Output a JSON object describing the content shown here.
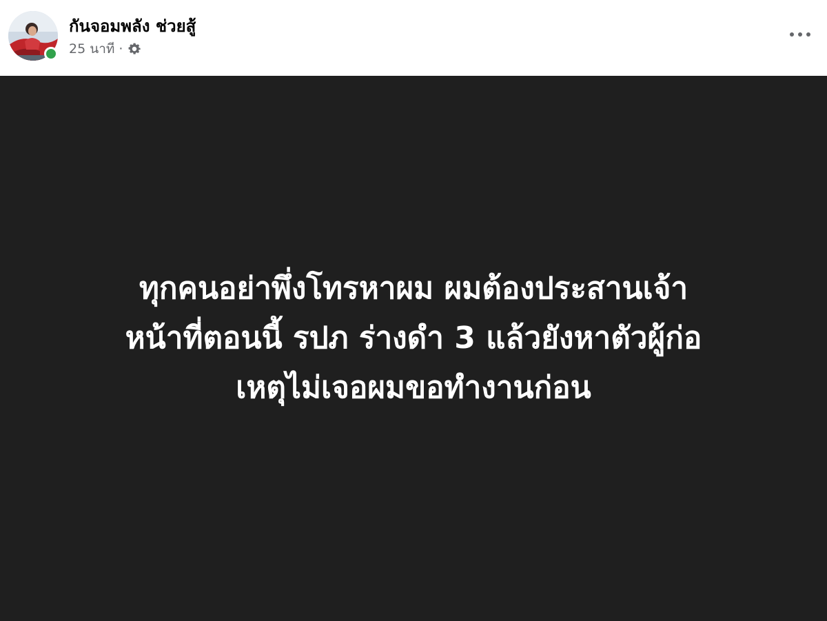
{
  "post": {
    "author": {
      "name": "กันจอมพลัง ช่วยสู้",
      "online": true,
      "online_color": "#31a24c"
    },
    "meta": {
      "time": "25 นาที",
      "separator": "·",
      "privacy_icon": "gear-icon"
    },
    "menu_icon": "more-options-icon",
    "status": {
      "background": "#1f1f1f",
      "text_color": "#ffffff",
      "lines": [
        "ทุกคนอย่าพึ่งโทรหาผม ผมต้องประสานเจ้า",
        "หน้าที่ตอนนี้ รปภ ร่างดำ 3 แล้วยังหาตัวผู้ก่อ",
        "เหตุไม่เจอผมขอทำงานก่อน"
      ]
    }
  }
}
